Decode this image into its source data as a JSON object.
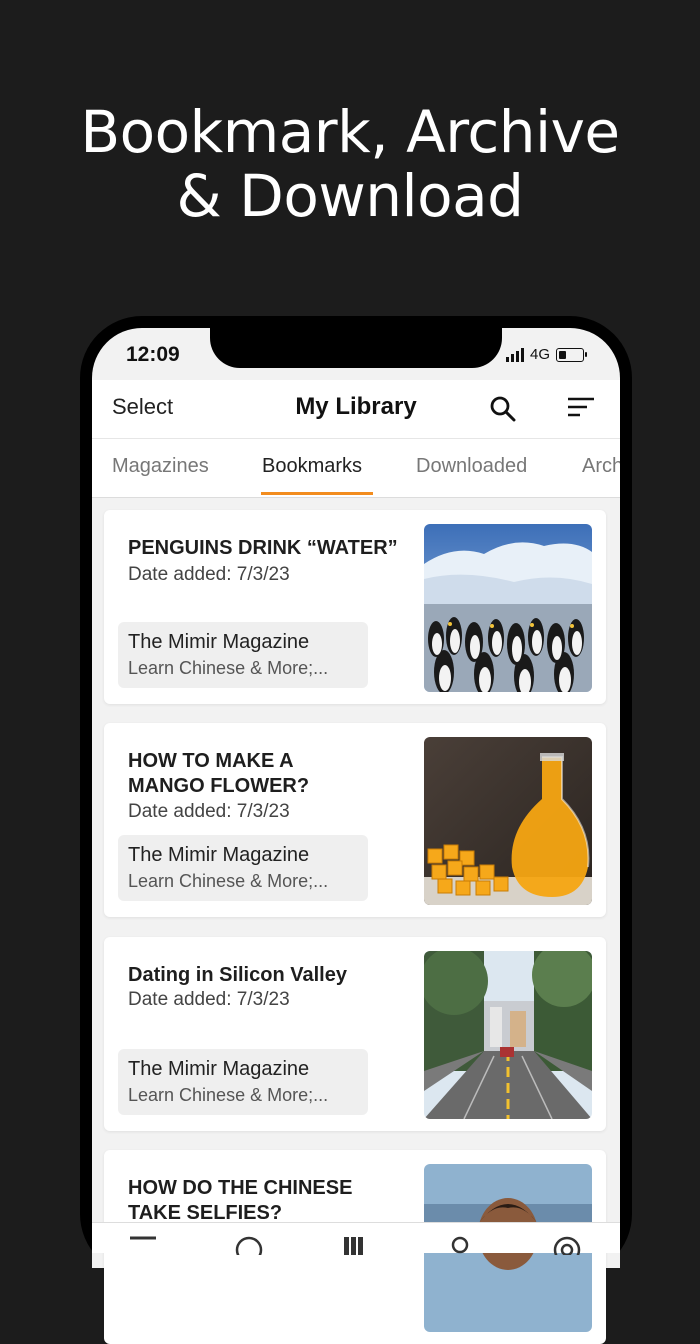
{
  "headline": {
    "line1": "Bookmark, Archive",
    "line2": "& Download"
  },
  "status_bar": {
    "time": "12:09",
    "network": "4G"
  },
  "app_bar": {
    "select_label": "Select",
    "title": "My Library"
  },
  "tabs": [
    {
      "label": "Magazines",
      "active": false
    },
    {
      "label": "Bookmarks",
      "active": true
    },
    {
      "label": "Downloaded",
      "active": false
    },
    {
      "label": "Archived",
      "active": false
    }
  ],
  "accent_color": "#f28c1e",
  "articles": [
    {
      "title": "PENGUINS DRINK “WATER”",
      "date": "Date added: 7/3/23",
      "publication": "The Mimir Magazine",
      "publication_desc": "Learn Chinese & More;...",
      "image": "penguins-photo"
    },
    {
      "title_line1": "HOW TO MAKE A",
      "title_line2": "MANGO FLOWER?",
      "date": "Date added: 7/3/23",
      "publication": "The Mimir Magazine",
      "publication_desc": "Learn Chinese & More;...",
      "image": "mango-juice-photo"
    },
    {
      "title": "Dating in Silicon Valley",
      "date": "Date added: 7/3/23",
      "publication": "The Mimir Magazine",
      "publication_desc": "Learn Chinese & More;...",
      "image": "san-francisco-street-photo"
    },
    {
      "title_line1": "HOW DO THE CHINESE",
      "title_line2": "TAKE SELFIES?",
      "image": "selfie-photo"
    }
  ],
  "bottom_nav_icons": [
    "menu-icon",
    "compass-icon",
    "library-icon",
    "profile-icon",
    "settings-icon"
  ]
}
